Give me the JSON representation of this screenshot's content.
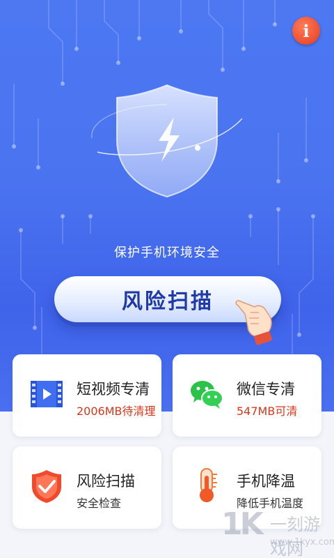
{
  "header": {
    "info_icon": "info-icon",
    "info_label": "i"
  },
  "hero": {
    "shield_icon": "lightning-shield-icon",
    "tagline": "保护手机环境安全",
    "scan_button_label": "风险扫描"
  },
  "cards": [
    {
      "icon": "video-clean-icon",
      "title": "短视频专清",
      "subtitle": "2006MB待清理",
      "subtitle_color": "#d8371a"
    },
    {
      "icon": "wechat-icon",
      "title": "微信专清",
      "subtitle": "547MB可清",
      "subtitle_color": "#d8371a"
    },
    {
      "icon": "shield-check-icon",
      "title": "风险扫描",
      "subtitle": "安全检查",
      "subtitle_color": "#333333"
    },
    {
      "icon": "thermometer-icon",
      "title": "手机降温",
      "subtitle": "降低手机温度",
      "subtitle_color": "#333333"
    }
  ],
  "watermark": {
    "logo": "1K",
    "name": "一刻游戏网",
    "url": "www.1kyx.com"
  },
  "colors": {
    "hero_blue": "#4a73f0",
    "accent_red": "#d8371a",
    "wechat_green": "#2bc24a"
  }
}
